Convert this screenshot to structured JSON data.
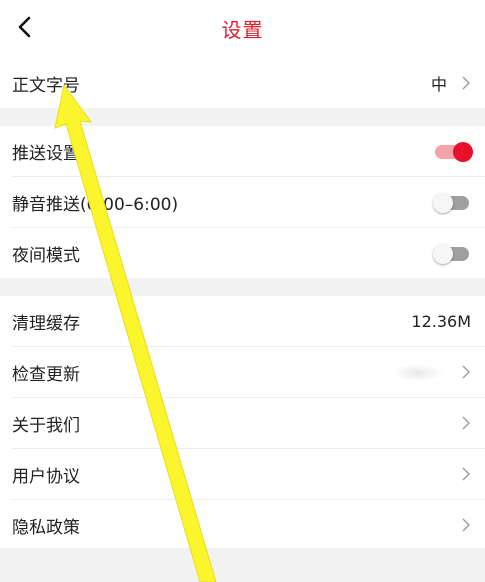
{
  "header": {
    "title": "设置",
    "back_icon": "chevron-left-icon",
    "title_color": "#e0202a"
  },
  "rows": {
    "font_size": {
      "label": "正文字号",
      "value": "中"
    },
    "push": {
      "label": "推送设置",
      "on": true
    },
    "mute": {
      "label": "静音推送(0:00–6:00)",
      "on": false
    },
    "night": {
      "label": "夜间模式",
      "on": false
    },
    "cache": {
      "label": "清理缓存",
      "value": "12.36M"
    },
    "update": {
      "label": "检查更新"
    },
    "about": {
      "label": "关于我们"
    },
    "agreement": {
      "label": "用户协议"
    },
    "privacy": {
      "label": "隐私政策"
    }
  },
  "colors": {
    "accent": "#e8102a",
    "section_gap": "#f2f2f2",
    "annotation_arrow": "#fbf52e"
  }
}
